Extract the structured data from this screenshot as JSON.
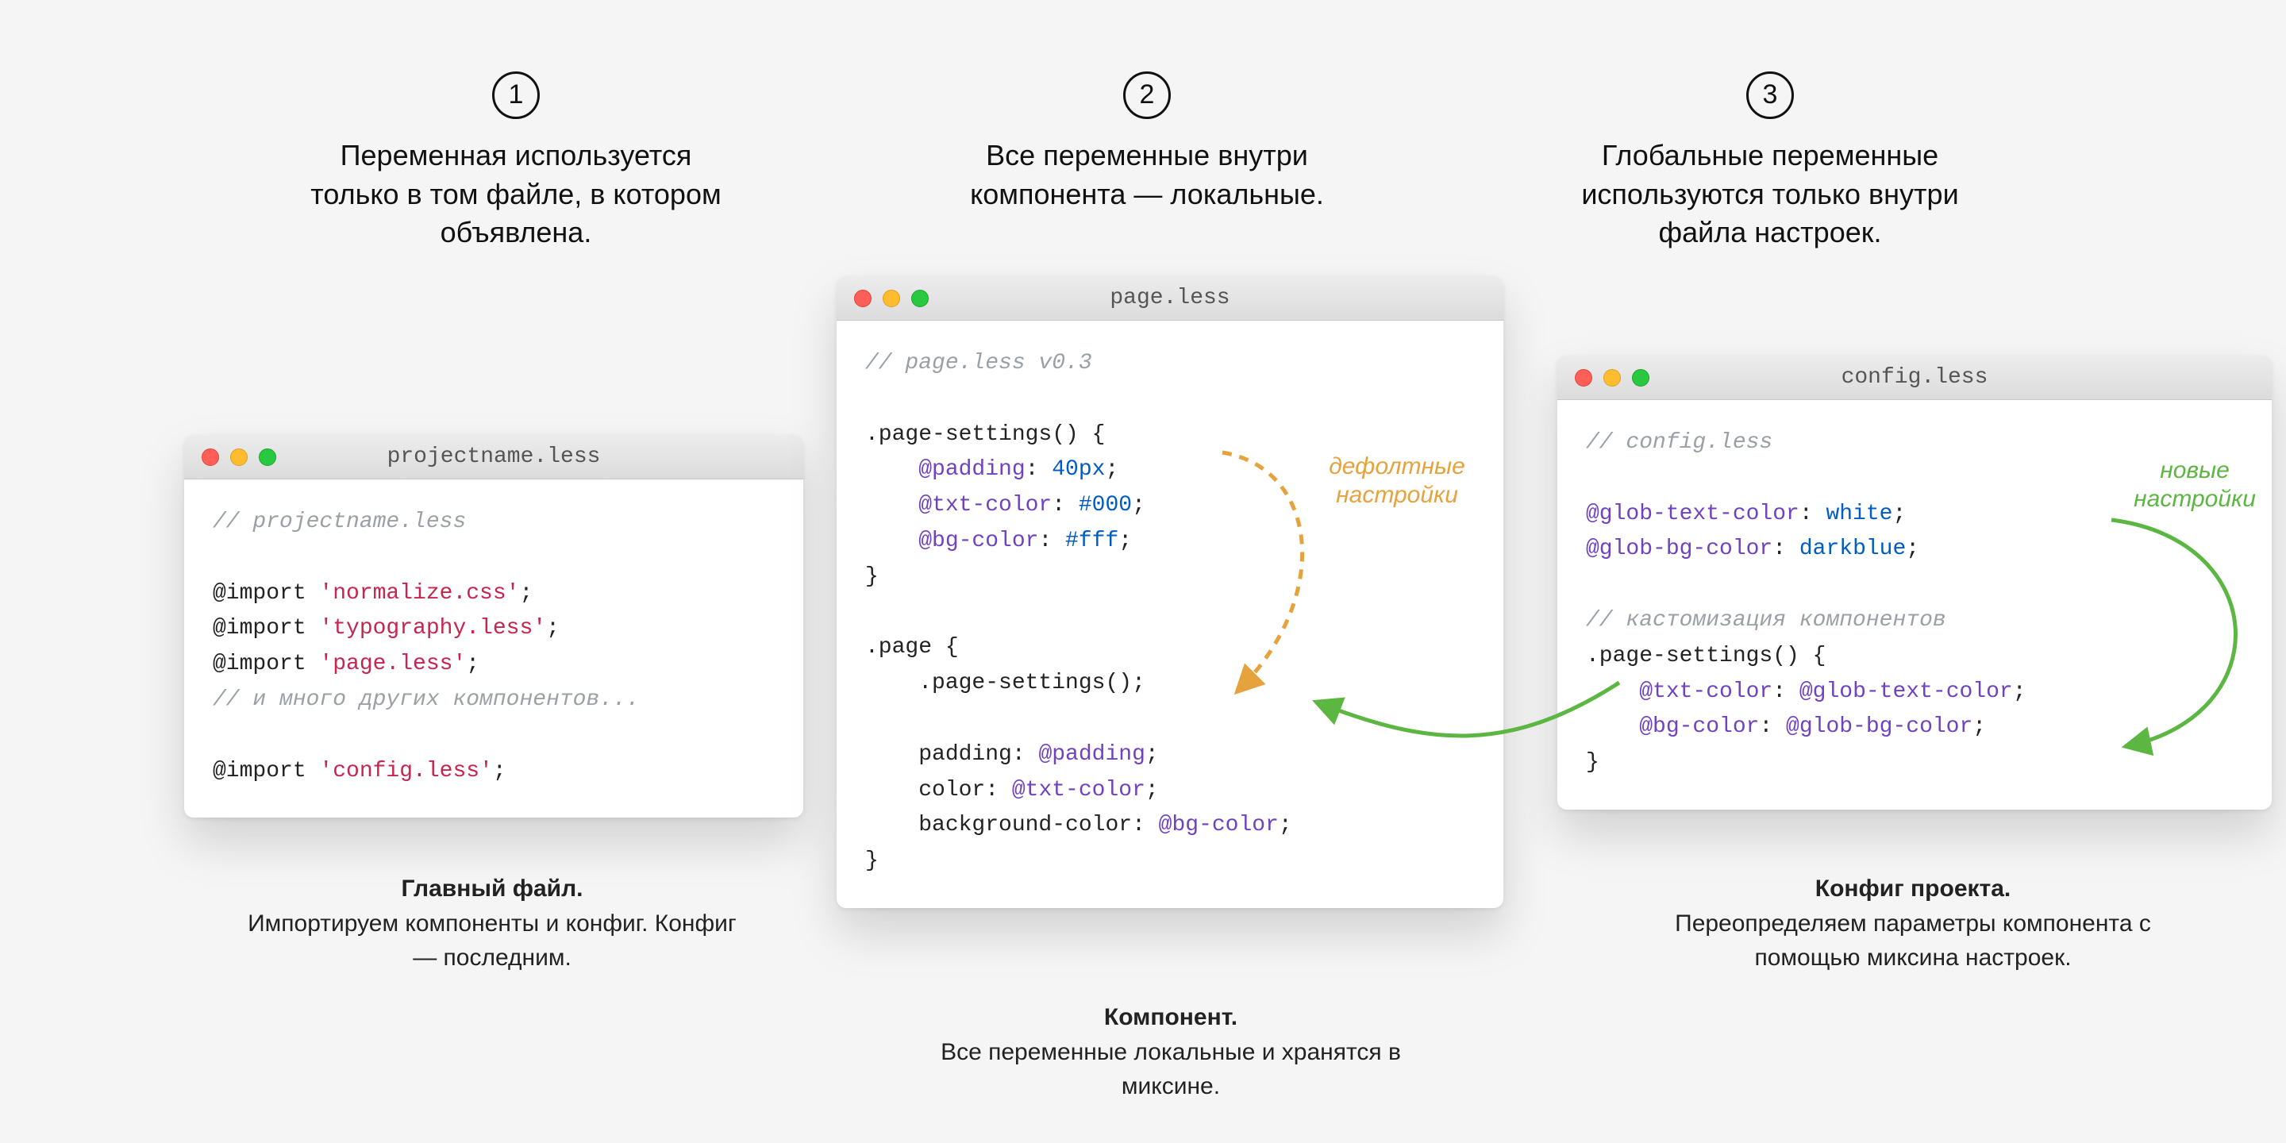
{
  "rules": {
    "r1_num": "1",
    "r1_text": "Переменная используется только в том файле, в котором объявлена.",
    "r2_num": "2",
    "r2_text": "Все переменные внутри компонента — локальные.",
    "r3_num": "3",
    "r3_text": "Глобальные переменные используются только внутри файла настроек."
  },
  "windows": {
    "project": {
      "title": "projectname.less",
      "code_comment": "// projectname.less",
      "code_imp1a": "@import ",
      "code_imp1b": "'normalize.css'",
      "code_imp1c": ";",
      "code_imp2a": "@import ",
      "code_imp2b": "'typography.less'",
      "code_imp2c": ";",
      "code_imp3a": "@import ",
      "code_imp3b": "'page.less'",
      "code_imp3c": ";",
      "code_comment2": "// и много других компонентов...",
      "code_imp4a": "@import ",
      "code_imp4b": "'config.less'",
      "code_imp4c": ";"
    },
    "page": {
      "title": "page.less",
      "c1": "// page.less v0.3",
      "l1": ".page-settings() {",
      "l2a": "    @padding",
      "l2b": ": ",
      "l2c": "40px",
      "l2d": ";",
      "l3a": "    @txt-color",
      "l3b": ": ",
      "l3c": "#000",
      "l3d": ";",
      "l4a": "    @bg-color",
      "l4b": ": ",
      "l4c": "#fff",
      "l4d": ";",
      "l5": "}",
      "l6": ".page {",
      "l7a": "    .page-settings()",
      "l7b": ";",
      "l8a": "    padding",
      "l8b": ": ",
      "l8c": "@padding",
      "l8d": ";",
      "l9a": "    color",
      "l9b": ": ",
      "l9c": "@txt-color",
      "l9d": ";",
      "l10a": "    background-color",
      "l10b": ": ",
      "l10c": "@bg-color",
      "l10d": ";",
      "l11": "}"
    },
    "config": {
      "title": "config.less",
      "c1": "// config.less",
      "l1a": "@glob-text-color",
      "l1b": ": ",
      "l1c": "white",
      "l1d": ";",
      "l2a": "@glob-bg-color",
      "l2b": ": ",
      "l2c": "darkblue",
      "l2d": ";",
      "c2": "// кастомизация компонентов",
      "l3": ".page-settings() {",
      "l4a": "    @txt-color",
      "l4b": ": ",
      "l4c": "@glob-text-color",
      "l4d": ";",
      "l5a": "    @bg-color",
      "l5b": ": ",
      "l5c": "@glob-bg-color",
      "l5d": ";",
      "l6": "}"
    }
  },
  "captions": {
    "project_b": "Главный файл.",
    "project_t": "Импортируем компоненты и конфиг. Конфиг — последним.",
    "page_b": "Компонент.",
    "page_t": "Все переменные локальные и хранятся в миксине.",
    "config_b": "Конфиг проекта.",
    "config_t": "Переопределяем параметры компонента с помощью миксина настроек."
  },
  "annotations": {
    "default": "дефолтные настройки",
    "newset": "новые настройки"
  },
  "colors": {
    "orange": "#e6a23c",
    "green": "#5cb642"
  }
}
